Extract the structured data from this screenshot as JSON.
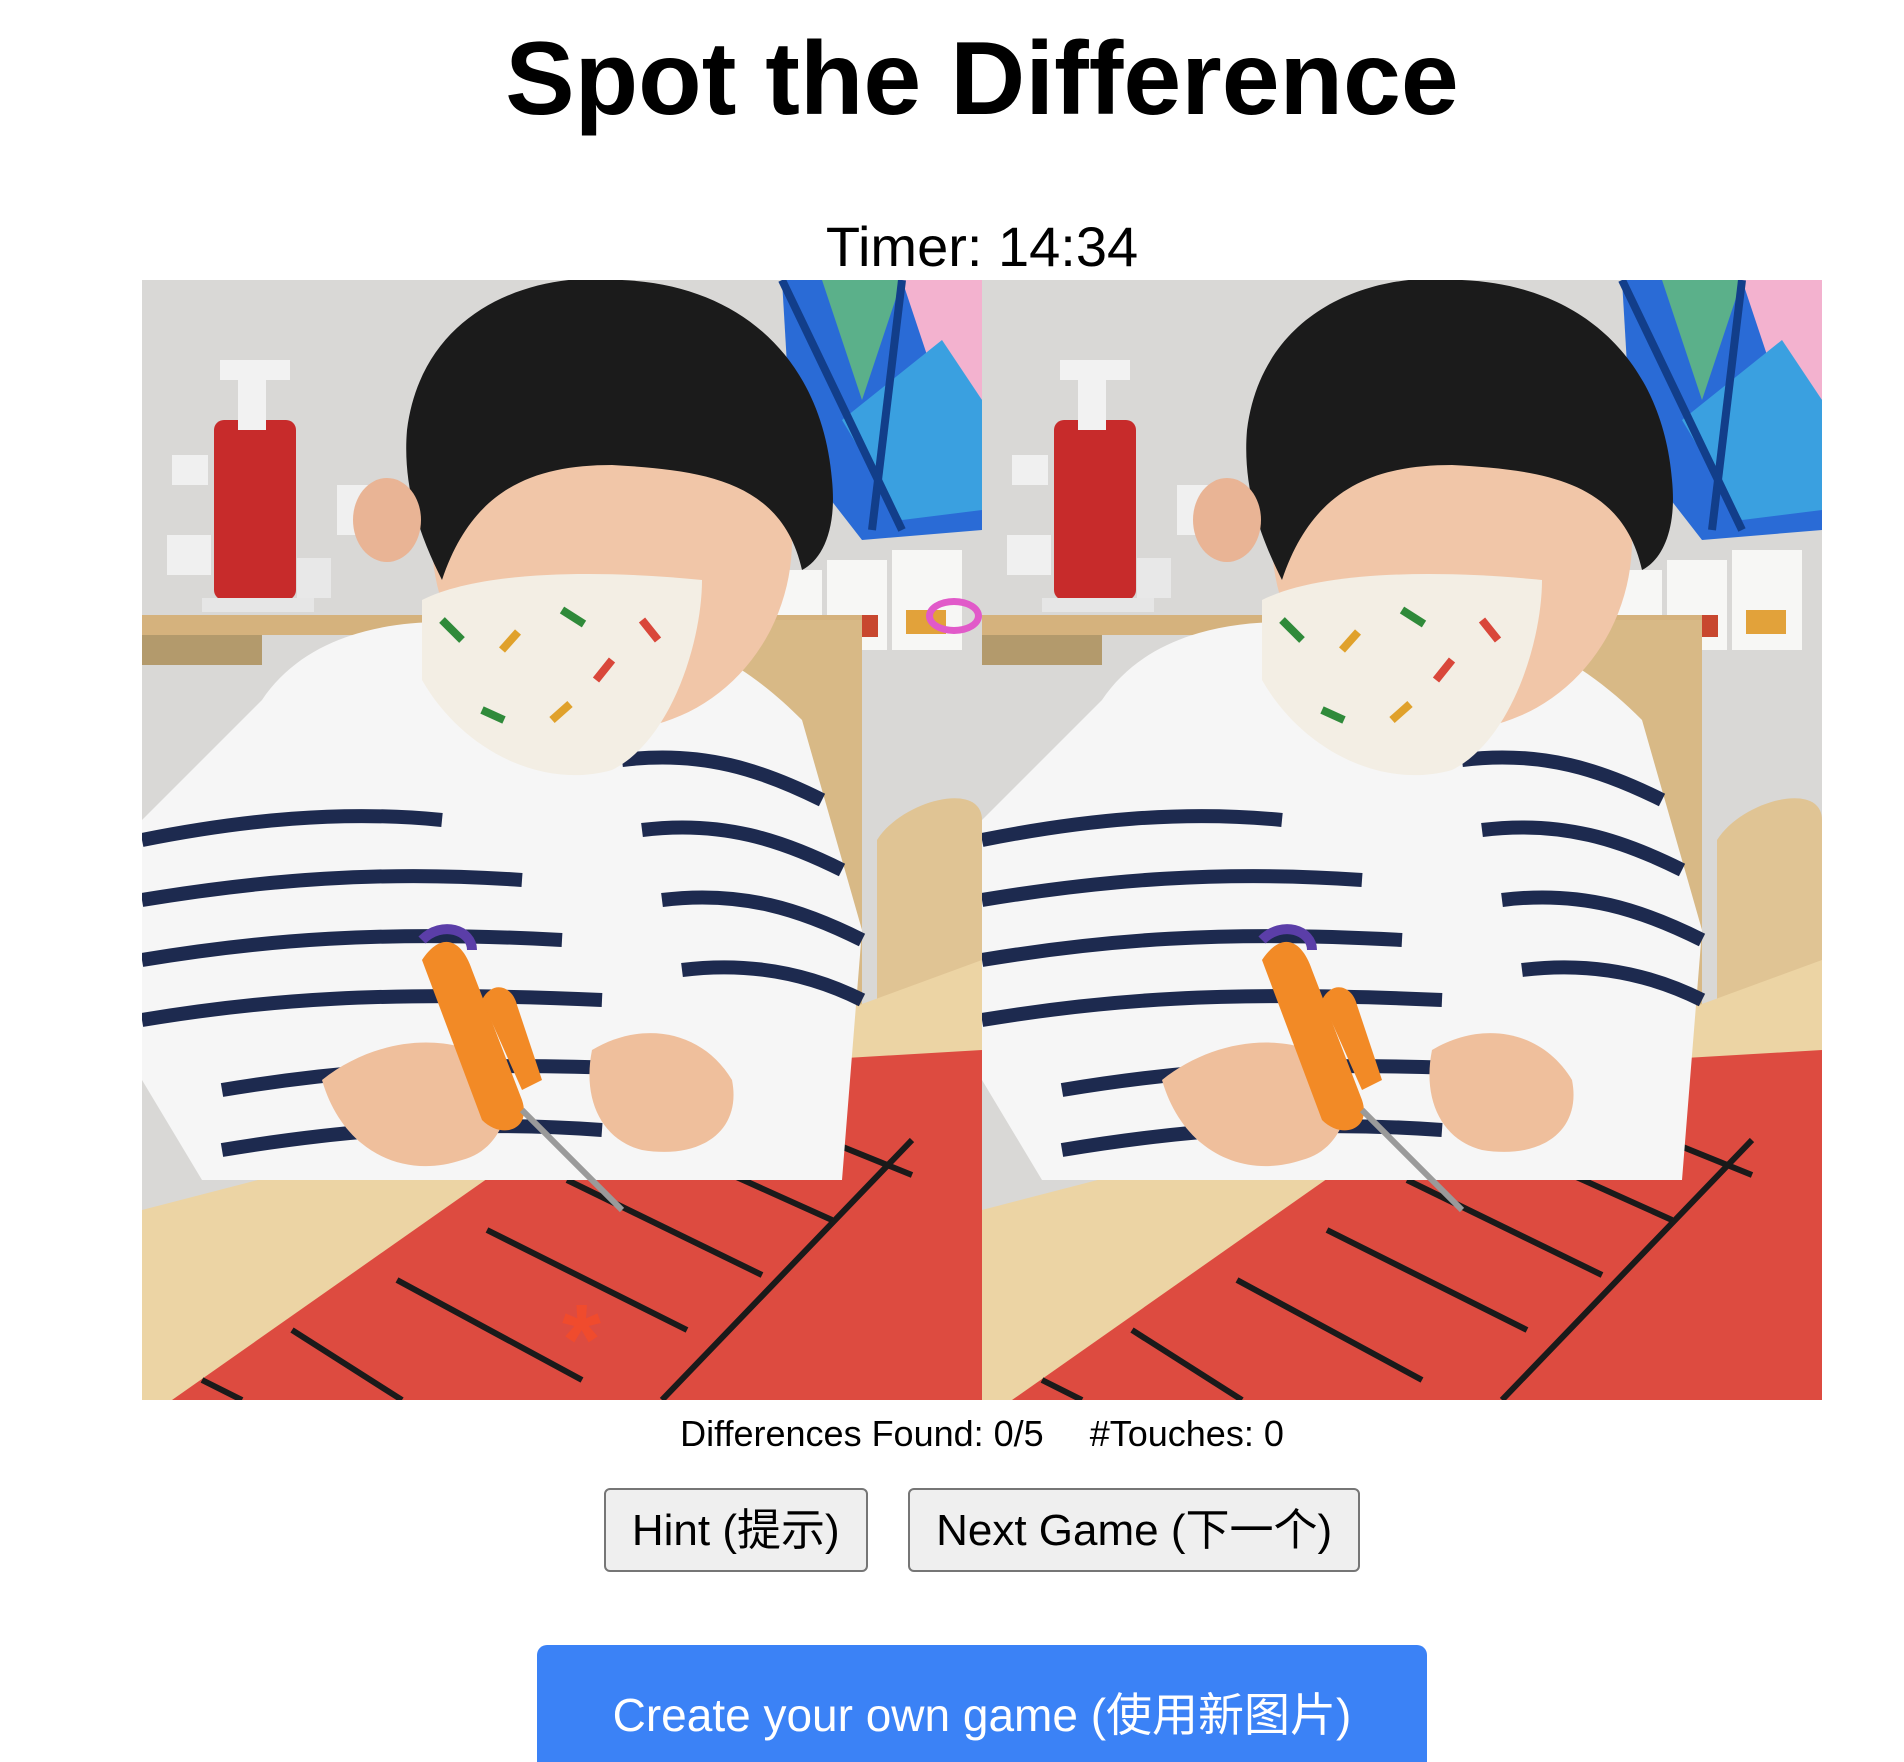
{
  "title": "Spot the Difference",
  "timer": "Timer: 14:34",
  "stats": {
    "differences_found": "Differences Found: 0/5",
    "touches": "#Touches: 0"
  },
  "buttons": {
    "hint": "Hint (提示)",
    "next_game": "Next Game (下一个)",
    "create": "Create your own game (使用新图片)"
  },
  "colors": {
    "accent": "#3b82f6",
    "paper_red": "#dd4b40",
    "difference_star": "#f04b2d",
    "difference_ring": "#e15ac9"
  },
  "images": {
    "left": "photo-left",
    "right": "photo-right"
  }
}
